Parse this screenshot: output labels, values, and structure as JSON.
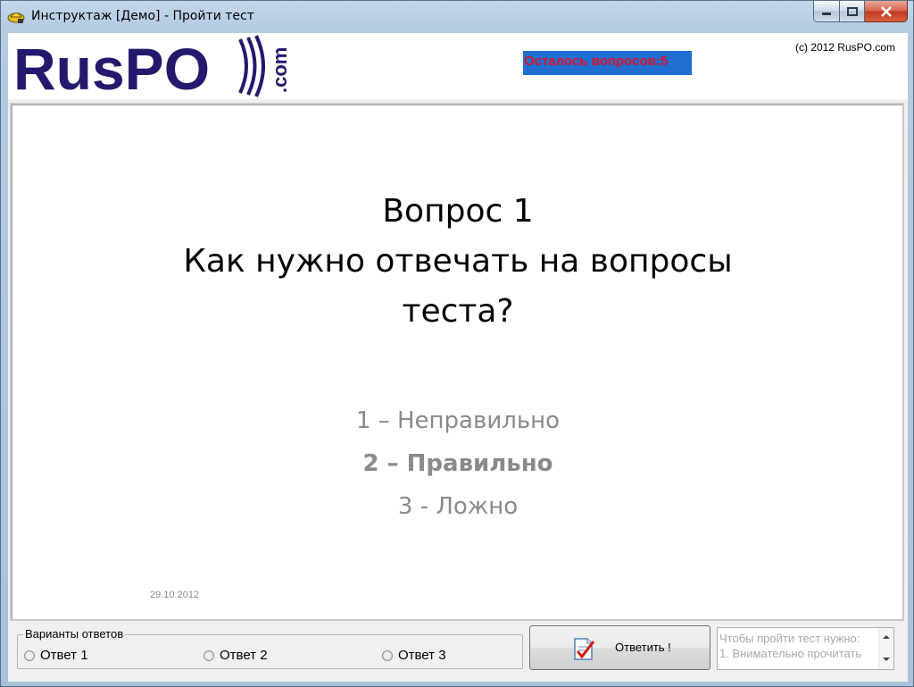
{
  "window": {
    "title": "Инструктаж [Демо] - Пройти тест"
  },
  "header": {
    "logo_text": "RusPO",
    "logo_suffix": ".com",
    "counter": "Осталось вопросов:5",
    "copyright": "(c) 2012 RusPO.com"
  },
  "slide": {
    "question_line1": "Вопрос 1",
    "question_line2": "Как нужно отвечать на вопросы",
    "question_line3": "теста?",
    "answers": [
      "1 – Неправильно",
      "2 – Правильно",
      "3 - Ложно"
    ],
    "date": "29.10.2012"
  },
  "answer_group": {
    "legend": "Варианты ответов",
    "options": [
      "Ответ 1",
      "Ответ 2",
      "Ответ 3"
    ]
  },
  "submit": {
    "label": "Ответить !"
  },
  "instructions": {
    "lines": [
      "Чтобы пройти тест нужно:",
      "1. Внимательно прочитать"
    ]
  },
  "colors": {
    "logo": "#231a6e",
    "counter_bg": "#1e6fd0",
    "counter_text": "#e0102a",
    "answer_text": "#8a8a8a"
  }
}
